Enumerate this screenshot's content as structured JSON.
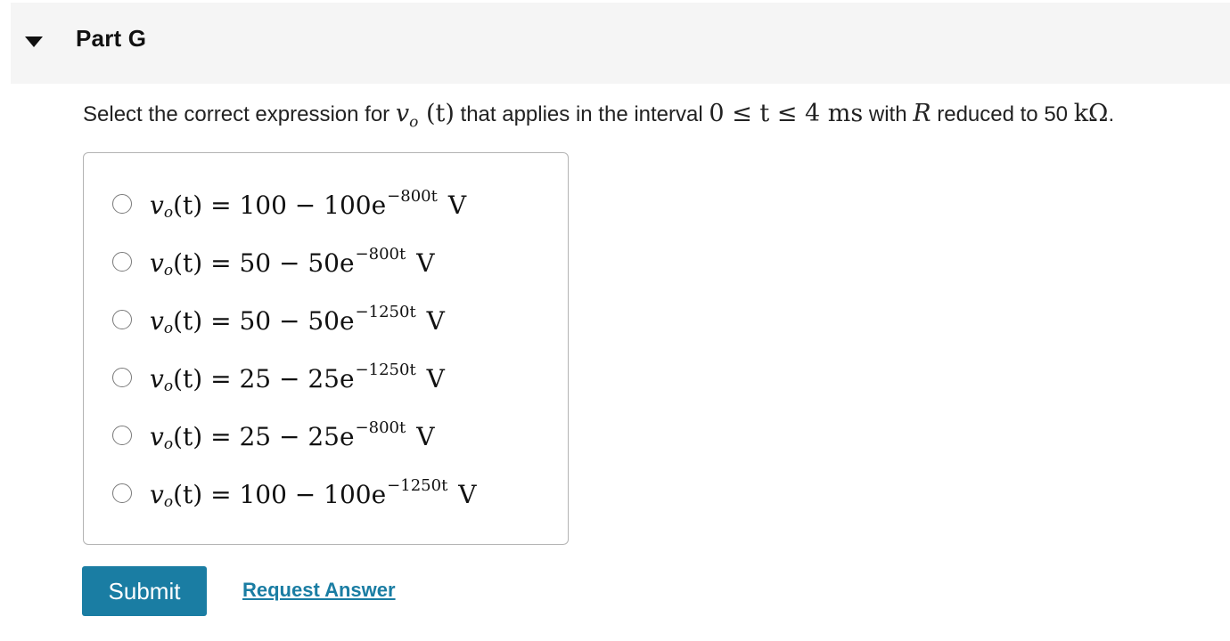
{
  "part": {
    "title": "Part G",
    "toggle_icon": "caret-down-icon"
  },
  "question": {
    "prefix": "Select the correct expression for ",
    "var": "v",
    "var_sub": "o",
    "var_arg": "(t)",
    "middle": " that applies in the interval ",
    "interval": "0 ≤ t ≤ 4 ms",
    "with_text": " with ",
    "r_symbol": "R",
    "suffix": " reduced to 50 ",
    "unit": "kΩ",
    "end": "."
  },
  "options": [
    {
      "lhs_var": "v",
      "lhs_sub": "o",
      "lhs_arg": "(t)",
      "rhs": " = 100 − 100e",
      "exponent": "−800t",
      "unit": "V"
    },
    {
      "lhs_var": "v",
      "lhs_sub": "o",
      "lhs_arg": "(t)",
      "rhs": " = 50 − 50e",
      "exponent": "−800t",
      "unit": "V"
    },
    {
      "lhs_var": "v",
      "lhs_sub": "o",
      "lhs_arg": "(t)",
      "rhs": " = 50 − 50e",
      "exponent": "−1250t",
      "unit": "V"
    },
    {
      "lhs_var": "v",
      "lhs_sub": "o",
      "lhs_arg": "(t)",
      "rhs": " = 25 − 25e",
      "exponent": "−1250t",
      "unit": "V"
    },
    {
      "lhs_var": "v",
      "lhs_sub": "o",
      "lhs_arg": "(t)",
      "rhs": " = 25 − 25e",
      "exponent": "−800t",
      "unit": "V"
    },
    {
      "lhs_var": "v",
      "lhs_sub": "o",
      "lhs_arg": "(t)",
      "rhs": " = 100 − 100e",
      "exponent": "−1250t",
      "unit": "V"
    }
  ],
  "actions": {
    "submit_label": "Submit",
    "request_answer_label": "Request Answer"
  },
  "colors": {
    "accent": "#1a7da3",
    "header_bg": "#f5f5f5",
    "border": "#b3b3b3"
  }
}
